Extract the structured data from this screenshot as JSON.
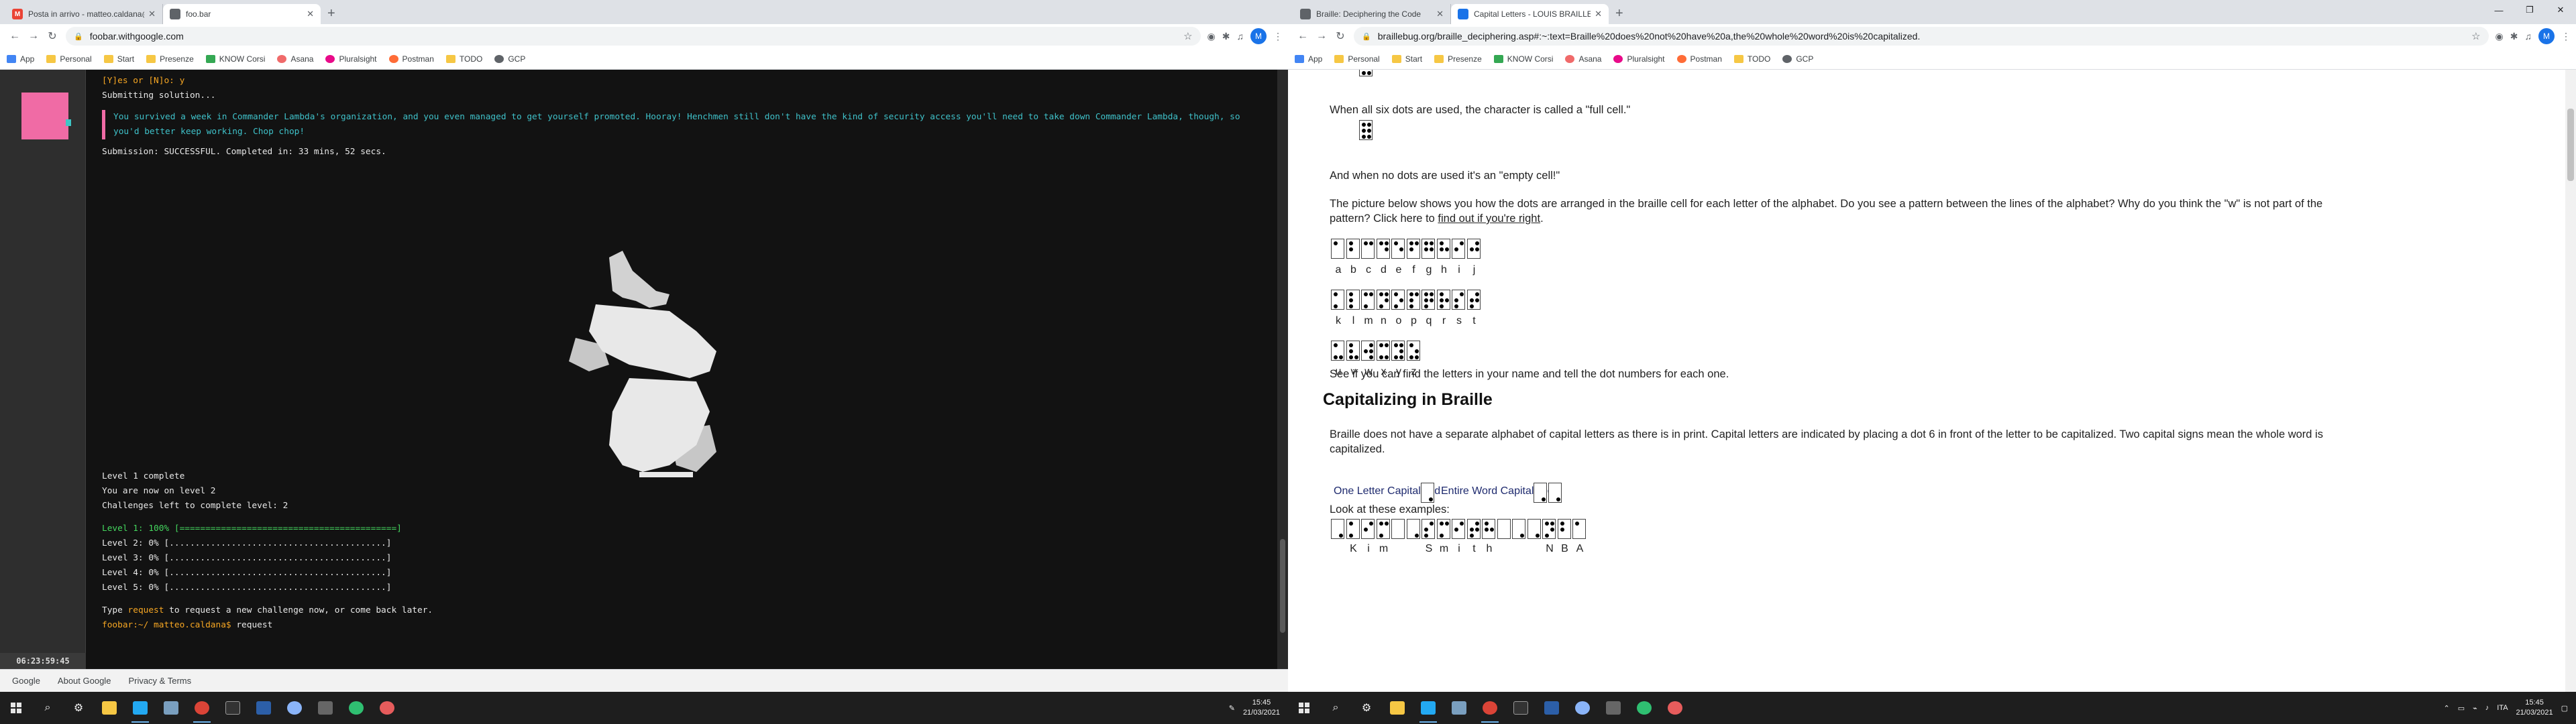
{
  "left": {
    "tabs": [
      {
        "title": "Posta in arrivo - matteo.caldana@",
        "favicon": "M",
        "color": "#ea4335"
      },
      {
        "title": "foo.bar",
        "favicon": "",
        "color": "#5f6368"
      }
    ],
    "url": "foobar.withgoogle.com",
    "bookmarks": [
      "App",
      "Personal",
      "Start",
      "Presenze",
      "KNOW Corsi",
      "Asana",
      "Pluralsight",
      "Postman",
      "TODO",
      "GCP"
    ],
    "terminal": {
      "prompt_line": "[Y]es or [N]o: y",
      "submitting": "Submitting solution...",
      "notice": "You survived a week in Commander Lambda's organization, and you even managed to get yourself promoted. Hooray! Henchmen still don't have the kind of security access you'll need to take down Commander Lambda, though, so you'd better keep working. Chop chop!",
      "submission": "Submission: SUCCESSFUL. Completed in: 33 mins, 52 secs.",
      "level_complete": "Level 1 complete",
      "now_on": "You are now on level 2",
      "challenges_left": "Challenges left to complete level: 2",
      "levels": [
        {
          "label": "Level 1: 100% [==========================================]"
        },
        {
          "label": "Level 2:   0% [..........................................]"
        },
        {
          "label": "Level 3:   0% [..........................................]"
        },
        {
          "label": "Level 4:   0% [..........................................]"
        },
        {
          "label": "Level 5:   0% [..........................................]"
        }
      ],
      "type_request_pre": "Type ",
      "type_request_kw": "request",
      "type_request_post": " to request a new challenge now, or come back later.",
      "prompt": "foobar:~/ matteo.caldana$",
      "command": "request",
      "timer": "06:23:59:45"
    },
    "footer": [
      "Google",
      "About Google",
      "Privacy & Terms"
    ],
    "clock": {
      "time": "15:45",
      "date": "21/03/2021"
    }
  },
  "right": {
    "tabs": [
      {
        "title": "Braille: Deciphering the Code",
        "color": "#5f6368"
      },
      {
        "title": "Capital Letters - LOUIS BRAILLE",
        "color": "#1a73e8"
      }
    ],
    "url": "braillebug.org/braille_deciphering.asp#:~:text=Braille%20does%20not%20have%20a,the%20whole%20word%20is%20capitalized.",
    "bookmarks": [
      "App",
      "Personal",
      "Start",
      "Presenze",
      "KNOW Corsi",
      "Asana",
      "Pluralsight",
      "Postman",
      "TODO",
      "GCP"
    ],
    "page": {
      "full_cell_text": "When all six dots are used, the character is called a \"full cell.\"",
      "empty_cell_text": "And when no dots are used it's an \"empty cell!\"",
      "picture_text_1": "The picture below shows you how the dots are arranged in the braille cell for each letter of the alphabet. Do you see a pattern between the lines of the alphabet? Why do you think the \"w\" is not part of the",
      "picture_text_2_pre": "pattern? Click here to ",
      "picture_link": "find out if you're right",
      "picture_text_2_post": ".",
      "names_text": "See if you can find the letters in your name and tell the dot numbers for each one.",
      "heading_caps": "Capitalizing in Braille",
      "caps_text_1": "Braille does not have a separate alphabet of capital letters as there is in print. Capital letters are indicated by placing a dot 6 in front of the letter to be capitalized. Two capital signs mean the whole word is",
      "caps_text_2": "capitalized.",
      "one_letter": "One Letter Capitalized",
      "entire_word": "Entire Word Capitalized",
      "examples": "Look at these examples:",
      "alphabet_rows": [
        [
          "a",
          "b",
          "c",
          "d",
          "e",
          "f",
          "g",
          "h",
          "i",
          "j"
        ],
        [
          "k",
          "l",
          "m",
          "n",
          "o",
          "p",
          "q",
          "r",
          "s",
          "t"
        ],
        [
          "u",
          "v",
          "w",
          "x",
          "y",
          "z"
        ]
      ],
      "example_labels": [
        "K",
        "i",
        "m",
        "",
        "",
        "S",
        "m",
        "i",
        "t",
        "h",
        "",
        "",
        "",
        "N",
        "B",
        "A"
      ]
    },
    "clock": {
      "time": "15:45",
      "date": "21/03/2021"
    },
    "tray_lang": "ITA"
  },
  "chart_data": null
}
